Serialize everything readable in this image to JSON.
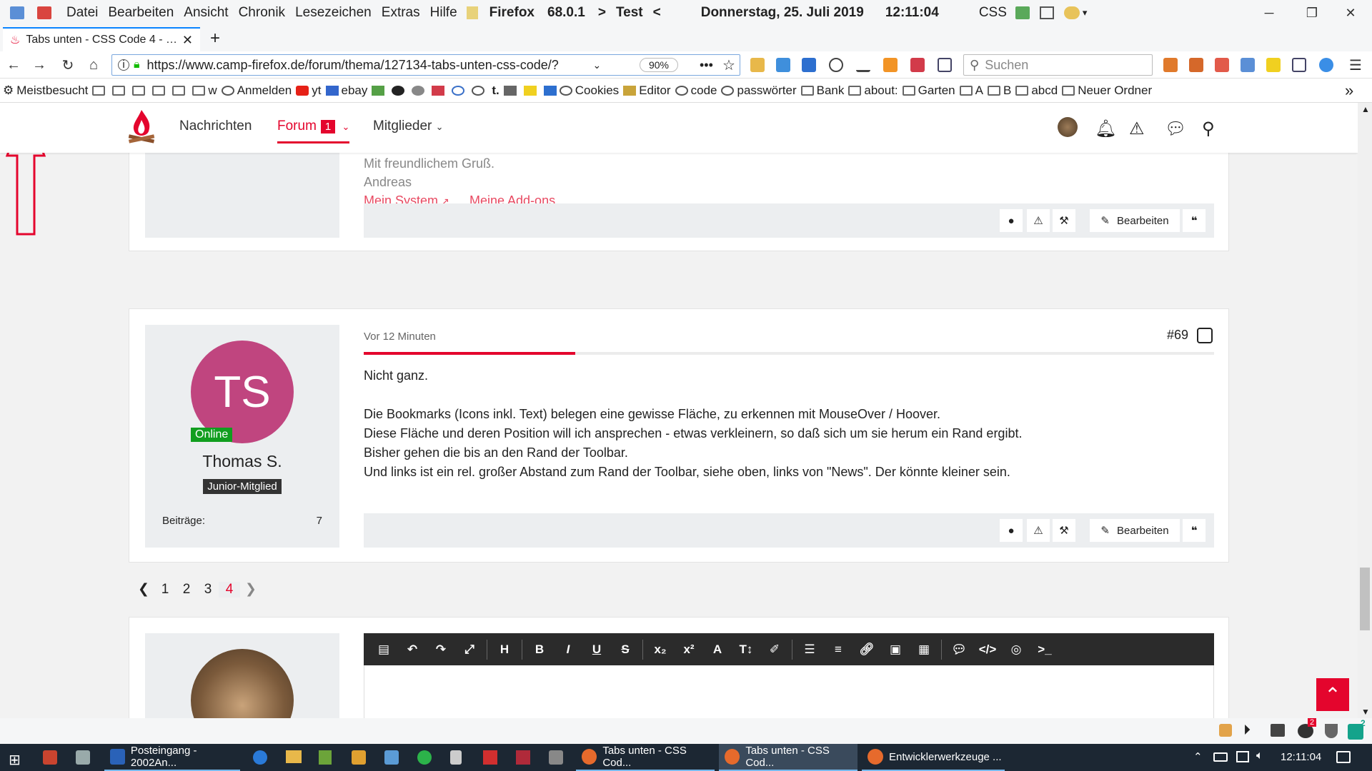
{
  "menubar": {
    "items": [
      "Datei",
      "Bearbeiten",
      "Ansicht",
      "Chronik",
      "Lesezeichen",
      "Extras",
      "Hilfe"
    ],
    "browser_name": "Firefox",
    "version": "68.0.1",
    "arrow_left": ">",
    "test_label": "Test",
    "arrow_right": "<",
    "date": "Donnerstag, 25. Juli 2019",
    "time": "12:11:04",
    "css_label": "CSS"
  },
  "tab": {
    "title": "Tabs unten - CSS Code 4 - …"
  },
  "navbar": {
    "url": "https://www.camp-firefox.de/forum/thema/127134-tabs-unten-css-code/?",
    "zoom": "90%",
    "search_placeholder": "Suchen"
  },
  "bookmarks": {
    "most_visited": "Meistbesucht",
    "items": [
      "w",
      "Anmelden",
      "yt",
      "ebay",
      "t.",
      "Cookies",
      "Editor",
      "code",
      "passwörter",
      "Bank",
      "about:",
      "Garten",
      "A",
      "B",
      "abcd",
      "Neuer Ordner"
    ]
  },
  "site": {
    "nav": {
      "news": "Nachrichten",
      "forum": "Forum",
      "forum_badge": "1",
      "members": "Mitglieder"
    }
  },
  "post_prev": {
    "greeting": "Mit freundlichem Gruß.",
    "name": "Andreas",
    "link1": "Mein System",
    "link2": "Meine Add-ons",
    "edit_label": "Bearbeiten"
  },
  "post": {
    "time": "Vor 12 Minuten",
    "number": "#69",
    "initials": "TS",
    "online": "Online",
    "author": "Thomas S.",
    "rank": "Junior-Mitglied",
    "posts_label": "Beiträge:",
    "posts_count": "7",
    "lines": [
      "Nicht ganz.",
      "",
      "Die Bookmarks (Icons inkl. Text) belegen eine gewisse Fläche, zu erkennen mit MouseOver / Hoover.",
      "Diese Fläche und deren Position will ich ansprechen - etwas verkleinern, so daß sich um sie herum ein Rand ergibt.",
      "Bisher gehen die bis an den Rand der Toolbar.",
      "Und links ist ein rel. großer Abstand zum Rand der Toolbar, siehe oben, links von \"News\". Der könnte kleiner sein."
    ],
    "edit_label": "Bearbeiten"
  },
  "pager": {
    "pages": [
      "1",
      "2",
      "3",
      "4"
    ],
    "current": "4"
  },
  "taskbar": {
    "tasks": [
      "Posteingang - 2002An...",
      "Tabs unten - CSS Cod...",
      "Tabs unten - CSS Cod...",
      "Entwicklerwerkzeuge ..."
    ],
    "time": "12:11:04",
    "badge_red": "2",
    "badge_green": "2"
  },
  "colors": {
    "accent": "#e4052d",
    "link": "#e84a62",
    "avatar": "#c0457f",
    "online": "#119e1f"
  }
}
